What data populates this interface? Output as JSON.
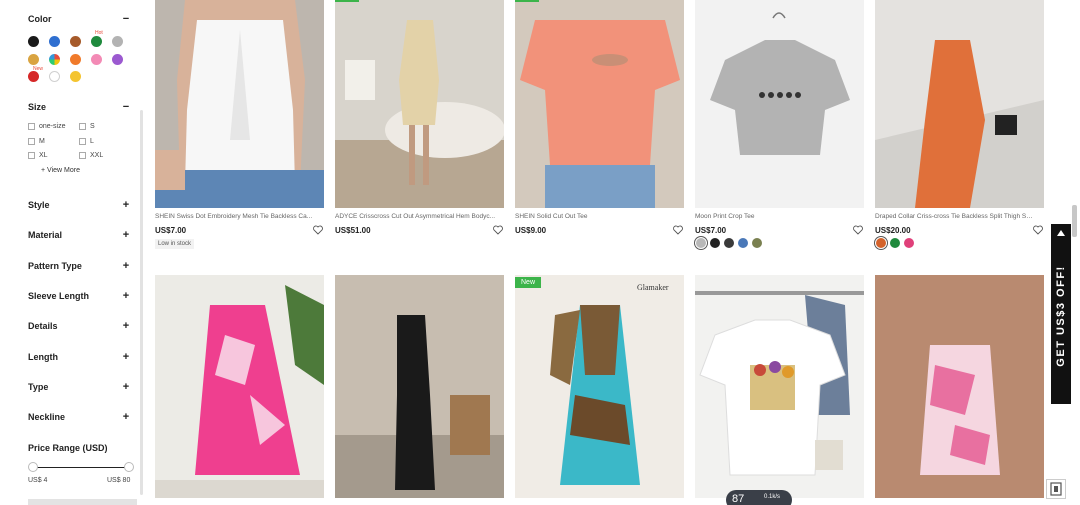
{
  "sidebar": {
    "color": {
      "title": "Color",
      "toggle": "−",
      "hot_badge": "Hot",
      "new_badge": "New"
    },
    "size": {
      "title": "Size",
      "toggle": "−",
      "options": [
        "one-size",
        "S",
        "M",
        "L",
        "XL",
        "XXL"
      ],
      "view_more": "+ View More"
    },
    "sections": [
      {
        "title": "Style",
        "toggle": "+"
      },
      {
        "title": "Material",
        "toggle": "+"
      },
      {
        "title": "Pattern Type",
        "toggle": "+"
      },
      {
        "title": "Sleeve Length",
        "toggle": "+"
      },
      {
        "title": "Details",
        "toggle": "+"
      },
      {
        "title": "Length",
        "toggle": "+"
      },
      {
        "title": "Type",
        "toggle": "+"
      },
      {
        "title": "Neckline",
        "toggle": "+"
      }
    ],
    "price": {
      "title": "Price Range (USD)",
      "min": "US$ 4",
      "max": "US$ 80"
    },
    "swatch_colors": [
      "#1a1a1a",
      "#2f6fd0",
      "#a65a2a",
      "#1f8a3d",
      "#b3b3b3",
      "#d9a441",
      "multicolor",
      "#f07a2a",
      "#f38ab5",
      "#9b59d0",
      "#d62828",
      "#ffffff",
      "#f4c430"
    ]
  },
  "products": [
    {
      "title": "SHEIN Swiss Dot Embroidery Mesh Tie Backless Ca...",
      "price": "US$7.00",
      "stock": "Low in stock"
    },
    {
      "title": "ADYCE Crisscross Cut Out Asymmetrical Hem Bodyc...",
      "price": "US$51.00"
    },
    {
      "title": "SHEIN Solid Cut Out Tee",
      "price": "US$9.00"
    },
    {
      "title": "Moon Print Crop Tee",
      "price": "US$7.00",
      "colors": [
        "#b8b8b8",
        "#222222",
        "#3a3a3a",
        "#4a78b8",
        "#7a8050"
      ]
    },
    {
      "title": "Draped Collar Criss-cross Tie Backless Split Thigh Sa...",
      "price": "US$20.00",
      "colors": [
        "#d4622a",
        "#1f8a3d",
        "#e0407a"
      ]
    },
    {
      "image_label": ""
    },
    {
      "image_label": ""
    },
    {
      "badge": "New",
      "image_label": "Glamaker"
    },
    {
      "image_label": ""
    },
    {
      "image_label": ""
    }
  ],
  "promo": {
    "text": "GET US$3 OFF!"
  },
  "float_widget": {
    "number": "87",
    "sub": "0.1k/s"
  }
}
